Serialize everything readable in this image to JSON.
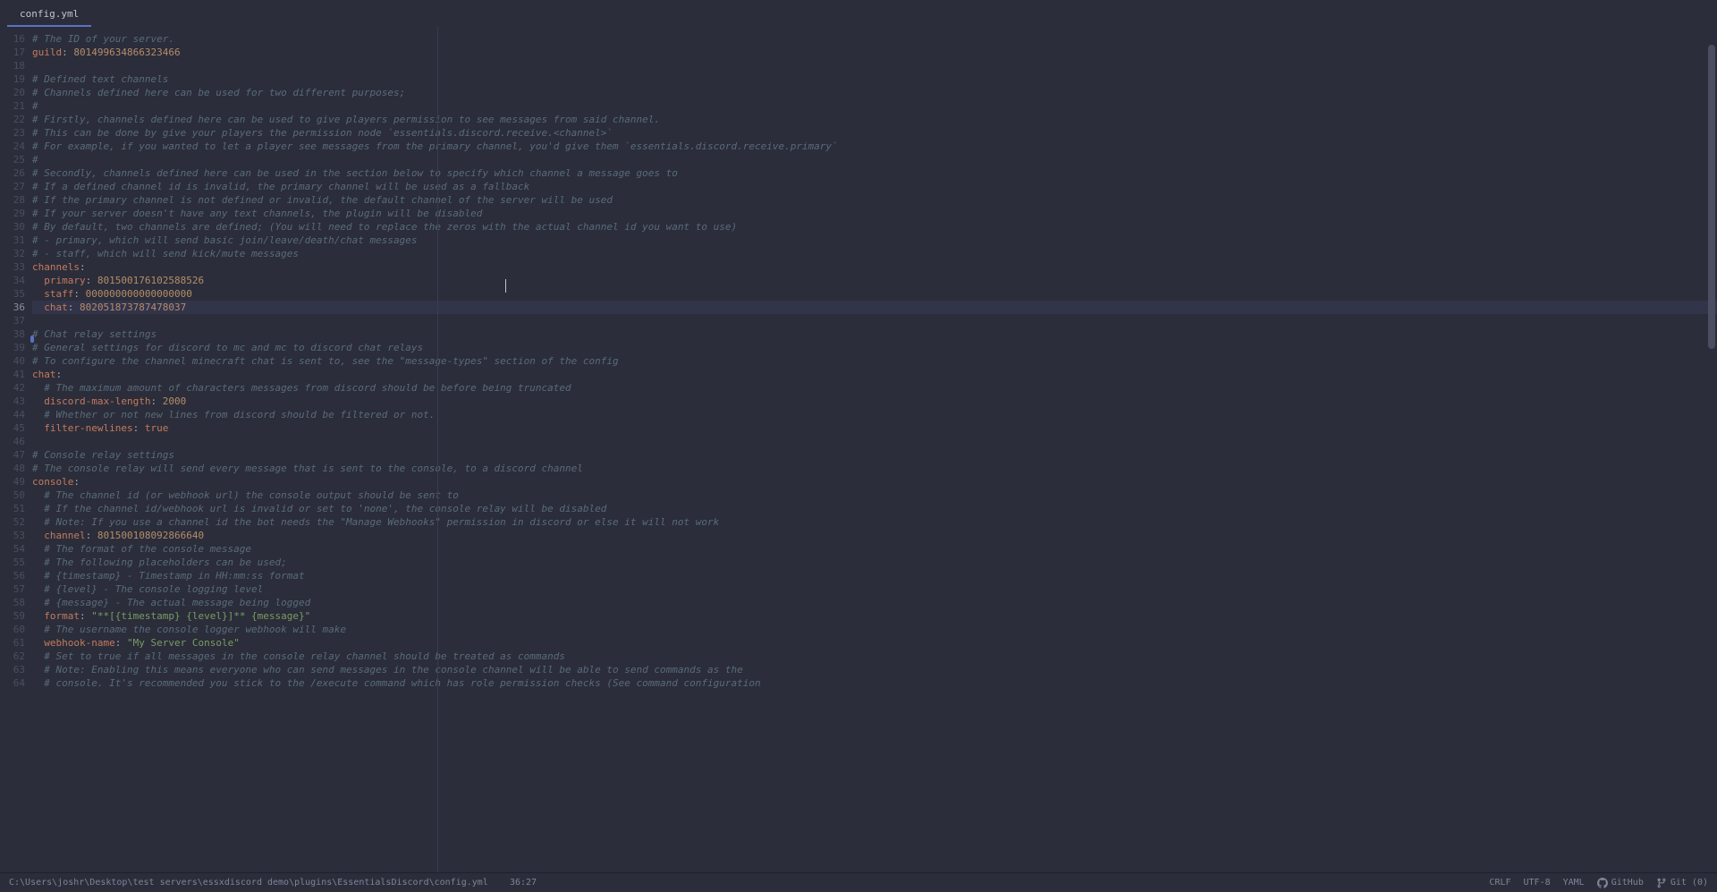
{
  "tab": {
    "name": "config.yml"
  },
  "lines": [
    {
      "n": 16,
      "tokens": [
        [
          "comment",
          "# The ID of your server."
        ]
      ]
    },
    {
      "n": 17,
      "tokens": [
        [
          "key",
          "guild"
        ],
        [
          "plain",
          ": "
        ],
        [
          "number",
          "801499634866323466"
        ]
      ]
    },
    {
      "n": 18,
      "tokens": []
    },
    {
      "n": 19,
      "tokens": [
        [
          "comment",
          "# Defined text channels"
        ]
      ]
    },
    {
      "n": 20,
      "tokens": [
        [
          "comment",
          "# Channels defined here can be used for two different purposes;"
        ]
      ]
    },
    {
      "n": 21,
      "tokens": [
        [
          "comment",
          "#"
        ]
      ]
    },
    {
      "n": 22,
      "tokens": [
        [
          "comment",
          "# Firstly, channels defined here can be used to give players permission to see messages from said channel."
        ]
      ]
    },
    {
      "n": 23,
      "tokens": [
        [
          "comment",
          "# This can be done by give your players the permission node `essentials.discord.receive.<channel>`"
        ]
      ]
    },
    {
      "n": 24,
      "tokens": [
        [
          "comment",
          "# For example, if you wanted to let a player see messages from the primary channel, you'd give them `essentials.discord.receive.primary`"
        ]
      ]
    },
    {
      "n": 25,
      "tokens": [
        [
          "comment",
          "#"
        ]
      ]
    },
    {
      "n": 26,
      "tokens": [
        [
          "comment",
          "# Secondly, channels defined here can be used in the section below to specify which channel a message goes to"
        ]
      ]
    },
    {
      "n": 27,
      "tokens": [
        [
          "comment",
          "# If a defined channel id is invalid, the primary channel will be used as a fallback"
        ]
      ]
    },
    {
      "n": 28,
      "tokens": [
        [
          "comment",
          "# If the primary channel is not defined or invalid, the default channel of the server will be used"
        ]
      ]
    },
    {
      "n": 29,
      "tokens": [
        [
          "comment",
          "# If your server doesn't have any text channels, the plugin will be disabled"
        ]
      ]
    },
    {
      "n": 30,
      "tokens": [
        [
          "comment",
          "# By default, two channels are defined; (You will need to replace the zeros with the actual channel id you want to use)"
        ]
      ]
    },
    {
      "n": 31,
      "tokens": [
        [
          "comment",
          "# - primary, which will send basic join/leave/death/chat messages"
        ]
      ]
    },
    {
      "n": 32,
      "tokens": [
        [
          "comment",
          "# - staff, which will send kick/mute messages"
        ]
      ]
    },
    {
      "n": 33,
      "tokens": [
        [
          "key",
          "channels"
        ],
        [
          "plain",
          ":"
        ]
      ]
    },
    {
      "n": 34,
      "tokens": [
        [
          "plain",
          "  "
        ],
        [
          "key",
          "primary"
        ],
        [
          "plain",
          ": "
        ],
        [
          "number",
          "801500176102588526"
        ]
      ]
    },
    {
      "n": 35,
      "tokens": [
        [
          "plain",
          "  "
        ],
        [
          "key",
          "staff"
        ],
        [
          "plain",
          ": "
        ],
        [
          "number",
          "000000000000000000"
        ]
      ]
    },
    {
      "n": 36,
      "tokens": [
        [
          "plain",
          "  "
        ],
        [
          "key",
          "chat"
        ],
        [
          "plain",
          ": "
        ],
        [
          "number",
          "802051873787478037"
        ]
      ],
      "active": true
    },
    {
      "n": 37,
      "tokens": []
    },
    {
      "n": 38,
      "tokens": [
        [
          "comment",
          "# Chat relay settings"
        ]
      ]
    },
    {
      "n": 39,
      "tokens": [
        [
          "comment",
          "# General settings for discord to mc and mc to discord chat relays"
        ]
      ]
    },
    {
      "n": 40,
      "tokens": [
        [
          "comment",
          "# To configure the channel minecraft chat is sent to, see the \"message-types\" section of the config"
        ]
      ]
    },
    {
      "n": 41,
      "tokens": [
        [
          "key",
          "chat"
        ],
        [
          "plain",
          ":"
        ]
      ]
    },
    {
      "n": 42,
      "tokens": [
        [
          "plain",
          "  "
        ],
        [
          "comment",
          "# The maximum amount of characters messages from discord should be before being truncated"
        ]
      ]
    },
    {
      "n": 43,
      "tokens": [
        [
          "plain",
          "  "
        ],
        [
          "key",
          "discord-max-length"
        ],
        [
          "plain",
          ": "
        ],
        [
          "number",
          "2000"
        ]
      ]
    },
    {
      "n": 44,
      "tokens": [
        [
          "plain",
          "  "
        ],
        [
          "comment",
          "# Whether or not new lines from discord should be filtered or not."
        ]
      ]
    },
    {
      "n": 45,
      "tokens": [
        [
          "plain",
          "  "
        ],
        [
          "key",
          "filter-newlines"
        ],
        [
          "plain",
          ": "
        ],
        [
          "bool",
          "true"
        ]
      ]
    },
    {
      "n": 46,
      "tokens": []
    },
    {
      "n": 47,
      "tokens": [
        [
          "comment",
          "# Console relay settings"
        ]
      ]
    },
    {
      "n": 48,
      "tokens": [
        [
          "comment",
          "# The console relay will send every message that is sent to the console, to a discord channel"
        ]
      ]
    },
    {
      "n": 49,
      "tokens": [
        [
          "key",
          "console"
        ],
        [
          "plain",
          ":"
        ]
      ]
    },
    {
      "n": 50,
      "tokens": [
        [
          "plain",
          "  "
        ],
        [
          "comment",
          "# The channel id (or webhook url) the console output should be sent to"
        ]
      ]
    },
    {
      "n": 51,
      "tokens": [
        [
          "plain",
          "  "
        ],
        [
          "comment",
          "# If the channel id/webhook url is invalid or set to 'none', the console relay will be disabled"
        ]
      ]
    },
    {
      "n": 52,
      "tokens": [
        [
          "plain",
          "  "
        ],
        [
          "comment",
          "# Note: If you use a channel id the bot needs the \"Manage Webhooks\" permission in discord or else it will not work"
        ]
      ]
    },
    {
      "n": 53,
      "tokens": [
        [
          "plain",
          "  "
        ],
        [
          "key",
          "channel"
        ],
        [
          "plain",
          ": "
        ],
        [
          "number",
          "801500108092866640"
        ]
      ]
    },
    {
      "n": 54,
      "tokens": [
        [
          "plain",
          "  "
        ],
        [
          "comment",
          "# The format of the console message"
        ]
      ]
    },
    {
      "n": 55,
      "tokens": [
        [
          "plain",
          "  "
        ],
        [
          "comment",
          "# The following placeholders can be used;"
        ]
      ]
    },
    {
      "n": 56,
      "tokens": [
        [
          "plain",
          "  "
        ],
        [
          "comment",
          "# {timestamp} - Timestamp in HH:mm:ss format"
        ]
      ]
    },
    {
      "n": 57,
      "tokens": [
        [
          "plain",
          "  "
        ],
        [
          "comment",
          "# {level} - The console logging level"
        ]
      ]
    },
    {
      "n": 58,
      "tokens": [
        [
          "plain",
          "  "
        ],
        [
          "comment",
          "# {message} - The actual message being logged"
        ]
      ]
    },
    {
      "n": 59,
      "tokens": [
        [
          "plain",
          "  "
        ],
        [
          "key",
          "format"
        ],
        [
          "plain",
          ": "
        ],
        [
          "string",
          "\"**[{timestamp} {level}]** {message}\""
        ]
      ]
    },
    {
      "n": 60,
      "tokens": [
        [
          "plain",
          "  "
        ],
        [
          "comment",
          "# The username the console logger webhook will make"
        ]
      ]
    },
    {
      "n": 61,
      "tokens": [
        [
          "plain",
          "  "
        ],
        [
          "key",
          "webhook-name"
        ],
        [
          "plain",
          ": "
        ],
        [
          "string",
          "\"My Server Console\""
        ]
      ]
    },
    {
      "n": 62,
      "tokens": [
        [
          "plain",
          "  "
        ],
        [
          "comment",
          "# Set to true if all messages in the console relay channel should be treated as commands"
        ]
      ]
    },
    {
      "n": 63,
      "tokens": [
        [
          "plain",
          "  "
        ],
        [
          "comment",
          "# Note: Enabling this means everyone who can send messages in the console channel will be able to send commands as the"
        ]
      ]
    },
    {
      "n": 64,
      "tokens": [
        [
          "plain",
          "  "
        ],
        [
          "comment",
          "# console. It's recommended you stick to the /execute command which has role permission checks (See command configuration"
        ]
      ]
    }
  ],
  "status": {
    "path": "C:\\Users\\joshr\\Desktop\\test servers\\essxdiscord demo\\plugins\\EssentialsDiscord\\config.yml",
    "position": "36:27",
    "lineEnding": "CRLF",
    "encoding": "UTF-8",
    "language": "YAML",
    "github": "GitHub",
    "git": "Git (0)"
  }
}
